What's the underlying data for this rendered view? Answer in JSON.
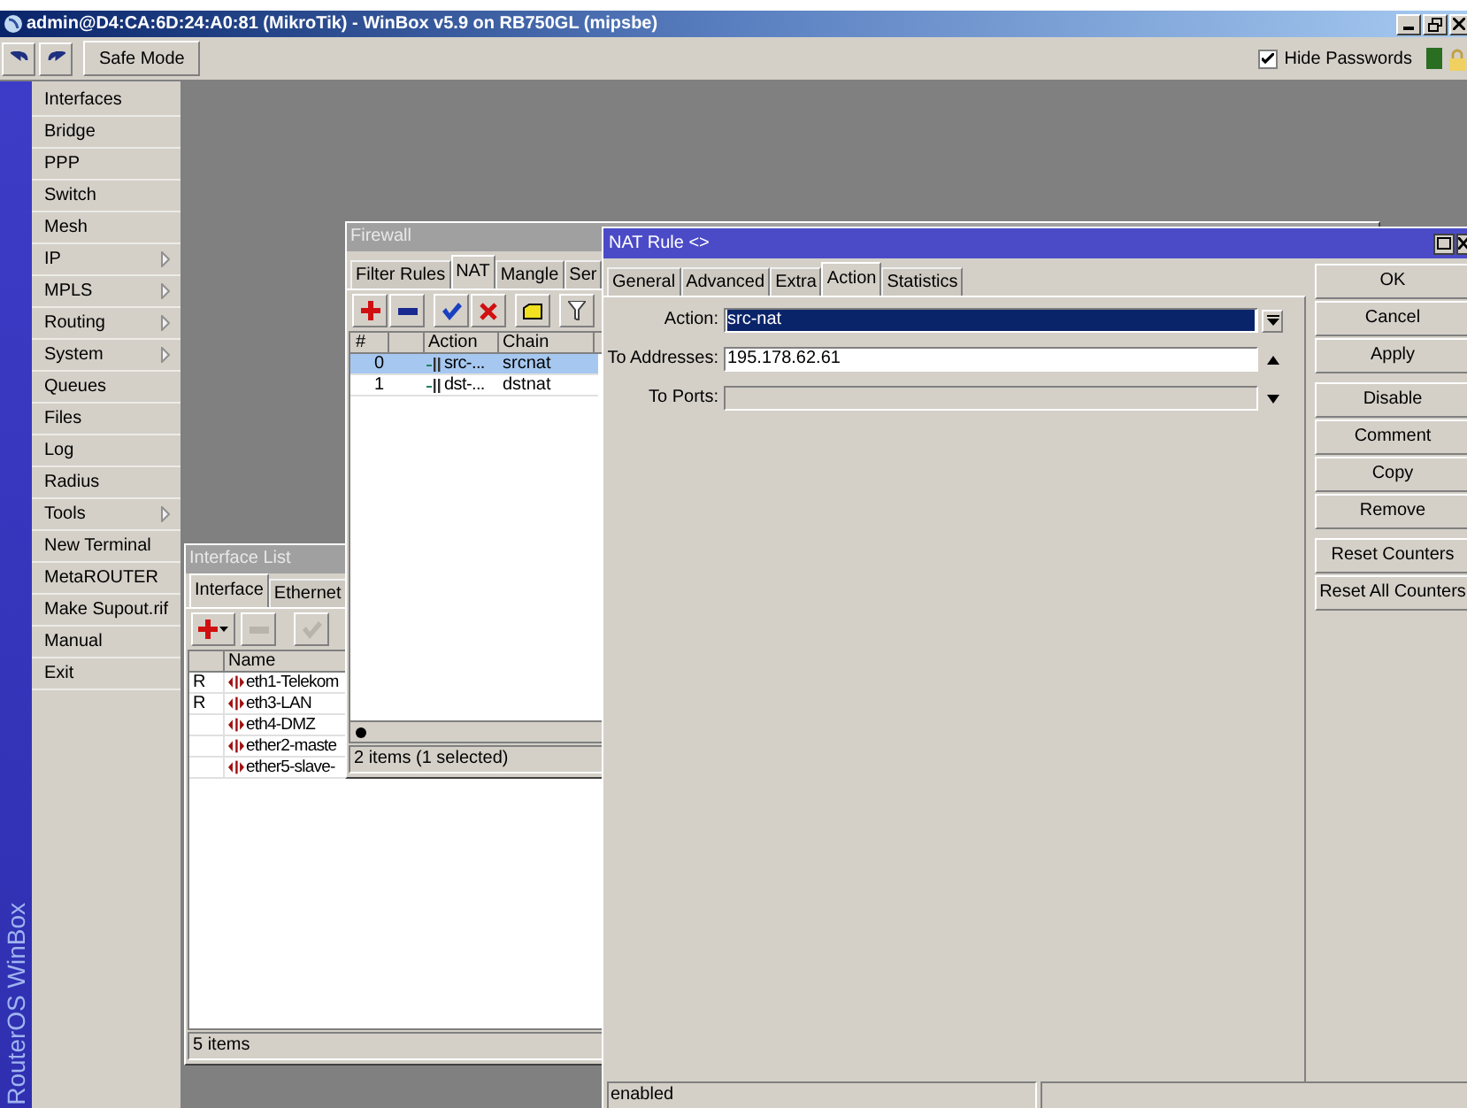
{
  "window": {
    "title": "admin@D4:CA:6D:24:A0:81 (MikroTik) - WinBox v5.9 on RB750GL (mipsbe)"
  },
  "toolbar": {
    "safe_mode": "Safe Mode",
    "hide_passwords": {
      "label": "Hide Passwords",
      "checked": true
    }
  },
  "sidebar": {
    "brand": "RouterOS WinBox",
    "items": [
      {
        "label": "Interfaces",
        "submenu": false
      },
      {
        "label": "Bridge",
        "submenu": false
      },
      {
        "label": "PPP",
        "submenu": false
      },
      {
        "label": "Switch",
        "submenu": false
      },
      {
        "label": "Mesh",
        "submenu": false
      },
      {
        "label": "IP",
        "submenu": true
      },
      {
        "label": "MPLS",
        "submenu": true
      },
      {
        "label": "Routing",
        "submenu": true
      },
      {
        "label": "System",
        "submenu": true
      },
      {
        "label": "Queues",
        "submenu": false
      },
      {
        "label": "Files",
        "submenu": false
      },
      {
        "label": "Log",
        "submenu": false
      },
      {
        "label": "Radius",
        "submenu": false
      },
      {
        "label": "Tools",
        "submenu": true
      },
      {
        "label": "New Terminal",
        "submenu": false
      },
      {
        "label": "MetaROUTER",
        "submenu": false
      },
      {
        "label": "Make Supout.rif",
        "submenu": false
      },
      {
        "label": "Manual",
        "submenu": false
      },
      {
        "label": "Exit",
        "submenu": false
      }
    ]
  },
  "interface_list": {
    "title": "Interface List",
    "tabs": [
      {
        "label": "Interface",
        "selected": true
      },
      {
        "label": "Ethernet",
        "selected": false
      }
    ],
    "columns": [
      "Name"
    ],
    "rows": [
      {
        "flag": "R",
        "name": "eth1-Telekom"
      },
      {
        "flag": "R",
        "name": "eth3-LAN"
      },
      {
        "name": "eth4-DMZ"
      },
      {
        "name": "ether2-maste"
      },
      {
        "name": "ether5-slave-"
      }
    ],
    "status": "5 items"
  },
  "firewall": {
    "title": "Firewall",
    "tabs": [
      {
        "label": "Filter Rules",
        "selected": false
      },
      {
        "label": "NAT",
        "selected": true
      },
      {
        "label": "Mangle",
        "selected": false
      },
      {
        "label": "Ser",
        "selected": false
      }
    ],
    "columns": [
      "#",
      "Action",
      "Chain"
    ],
    "rows": [
      {
        "number": "0",
        "action": "src-...",
        "chain": "srcnat",
        "selected": true
      },
      {
        "number": "1",
        "action": "dst-...",
        "chain": "dstnat",
        "selected": false
      }
    ],
    "status": "2 items (1 selected)"
  },
  "nat_rule": {
    "title": "NAT Rule <>",
    "tabs": [
      {
        "label": "General",
        "selected": false
      },
      {
        "label": "Advanced",
        "selected": false
      },
      {
        "label": "Extra",
        "selected": false
      },
      {
        "label": "Action",
        "selected": true
      },
      {
        "label": "Statistics",
        "selected": false
      }
    ],
    "fields": [
      {
        "kind": "select",
        "label": "Action:",
        "value": "src-nat",
        "highlighted": true
      },
      {
        "kind": "expandable",
        "label": "To Addresses:",
        "value": "195.178.62.61",
        "expanded": true,
        "disabled": false
      },
      {
        "kind": "expandable",
        "label": "To Ports:",
        "expanded": false,
        "disabled": true
      }
    ],
    "button_groups": [
      [
        "OK",
        "Cancel",
        "Apply"
      ],
      [
        "Disable",
        "Comment",
        "Copy",
        "Remove"
      ],
      [
        "Reset Counters",
        "Reset All Counters"
      ]
    ],
    "status": "enabled"
  }
}
